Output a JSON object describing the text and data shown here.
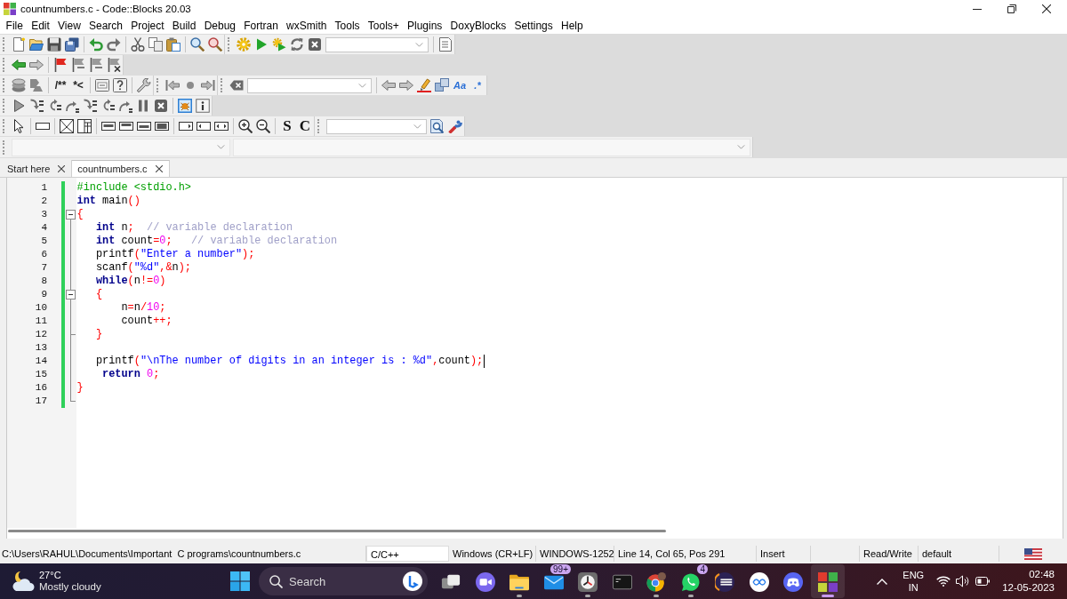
{
  "window": {
    "title": "countnumbers.c - Code::Blocks 20.03"
  },
  "menu": [
    "File",
    "Edit",
    "View",
    "Search",
    "Project",
    "Build",
    "Debug",
    "Fortran",
    "wxSmith",
    "Tools",
    "Tools+",
    "Plugins",
    "DoxyBlocks",
    "Settings",
    "Help"
  ],
  "toolbars": {
    "comment_buttons": [
      "/**",
      "*<"
    ],
    "search_buttons": [
      "Aa",
      ".*"
    ],
    "debug_toggles": [
      {
        "selected": true
      },
      {
        "selected": false
      }
    ],
    "wxsmith_buttons": [
      "S",
      "C"
    ]
  },
  "tabs": [
    {
      "label": "Start here",
      "selected": false
    },
    {
      "label": "countnumbers.c",
      "selected": true
    }
  ],
  "editor": {
    "lines": [
      {
        "number": "1",
        "modified": true,
        "kind": "plain",
        "caret": false,
        "tokens": [
          {
            "kind": "preprocessor",
            "text": "#include <stdio.h>"
          }
        ]
      },
      {
        "number": "2",
        "modified": true,
        "kind": "plain",
        "caret": false,
        "tokens": [
          {
            "kind": "keyword",
            "text": "int"
          },
          {
            "kind": "plain",
            "text": " main"
          },
          {
            "kind": "operator",
            "text": "()"
          }
        ]
      },
      {
        "number": "3",
        "modified": true,
        "kind": "fold_start",
        "caret": false,
        "tokens": [
          {
            "kind": "operator",
            "text": "{"
          }
        ]
      },
      {
        "number": "4",
        "modified": true,
        "kind": "fold_body",
        "caret": false,
        "tokens": [
          {
            "kind": "keyword",
            "text": "   int"
          },
          {
            "kind": "plain",
            "text": " n"
          },
          {
            "kind": "operator",
            "text": ";"
          },
          {
            "kind": "comment",
            "text": "  // variable declaration"
          }
        ]
      },
      {
        "number": "5",
        "modified": true,
        "kind": "fold_body",
        "caret": false,
        "tokens": [
          {
            "kind": "keyword",
            "text": "   int"
          },
          {
            "kind": "plain",
            "text": " count"
          },
          {
            "kind": "operator",
            "text": "="
          },
          {
            "kind": "number",
            "text": "0"
          },
          {
            "kind": "operator",
            "text": ";"
          },
          {
            "kind": "comment",
            "text": "   // variable declaration"
          }
        ]
      },
      {
        "number": "6",
        "modified": true,
        "kind": "fold_body",
        "caret": false,
        "tokens": [
          {
            "kind": "plain",
            "text": "   printf"
          },
          {
            "kind": "operator",
            "text": "("
          },
          {
            "kind": "string",
            "text": "\"Enter a number\""
          },
          {
            "kind": "operator",
            "text": ");"
          }
        ]
      },
      {
        "number": "7",
        "modified": true,
        "kind": "fold_body",
        "caret": false,
        "tokens": [
          {
            "kind": "plain",
            "text": "   scanf"
          },
          {
            "kind": "operator",
            "text": "("
          },
          {
            "kind": "string",
            "text": "\"%d\""
          },
          {
            "kind": "operator",
            "text": ",&"
          },
          {
            "kind": "plain",
            "text": "n"
          },
          {
            "kind": "operator",
            "text": ");"
          }
        ]
      },
      {
        "number": "8",
        "modified": true,
        "kind": "fold_body",
        "caret": false,
        "tokens": [
          {
            "kind": "keyword",
            "text": "   while"
          },
          {
            "kind": "operator",
            "text": "("
          },
          {
            "kind": "plain",
            "text": "n"
          },
          {
            "kind": "operator",
            "text": "!="
          },
          {
            "kind": "number",
            "text": "0"
          },
          {
            "kind": "operator",
            "text": ")"
          }
        ]
      },
      {
        "number": "9",
        "modified": true,
        "kind": "fold_start_inner",
        "caret": false,
        "tokens": [
          {
            "kind": "operator",
            "text": "   {"
          }
        ]
      },
      {
        "number": "10",
        "modified": true,
        "kind": "fold_body",
        "caret": false,
        "tokens": [
          {
            "kind": "plain",
            "text": "       n"
          },
          {
            "kind": "operator",
            "text": "="
          },
          {
            "kind": "plain",
            "text": "n"
          },
          {
            "kind": "operator",
            "text": "/"
          },
          {
            "kind": "number",
            "text": "10"
          },
          {
            "kind": "operator",
            "text": ";"
          }
        ]
      },
      {
        "number": "11",
        "modified": true,
        "kind": "fold_body",
        "caret": false,
        "tokens": [
          {
            "kind": "plain",
            "text": "       count"
          },
          {
            "kind": "operator",
            "text": "++;"
          }
        ]
      },
      {
        "number": "12",
        "modified": true,
        "kind": "fold_end_inner",
        "caret": false,
        "tokens": [
          {
            "kind": "operator",
            "text": "   }"
          }
        ]
      },
      {
        "number": "13",
        "modified": true,
        "kind": "fold_body",
        "caret": false
      },
      {
        "number": "14",
        "modified": true,
        "kind": "fold_body",
        "caret": true,
        "tokens": [
          {
            "kind": "plain",
            "text": "   printf"
          },
          {
            "kind": "operator",
            "text": "("
          },
          {
            "kind": "string",
            "text": "\"\\nThe number of digits in an integer is : %d\""
          },
          {
            "kind": "operator",
            "text": ","
          },
          {
            "kind": "plain",
            "text": "count"
          },
          {
            "kind": "operator",
            "text": ");"
          }
        ]
      },
      {
        "number": "15",
        "modified": true,
        "kind": "fold_body",
        "caret": false,
        "tokens": [
          {
            "kind": "keyword",
            "text": "    return"
          },
          {
            "kind": "number",
            "text": " 0"
          },
          {
            "kind": "operator",
            "text": ";"
          }
        ]
      },
      {
        "number": "16",
        "modified": true,
        "kind": "fold_body",
        "caret": false,
        "tokens": [
          {
            "kind": "operator",
            "text": "}"
          }
        ]
      },
      {
        "number": "17",
        "modified": true,
        "kind": "fold_end",
        "caret": false
      }
    ]
  },
  "status_bar": {
    "fields": [
      "C:\\Users\\RAHUL\\Documents\\Important  C programs\\countnumbers.c",
      "C/C++",
      "Windows (CR+LF)",
      "WINDOWS-1252",
      "Line 14, Col 65, Pos 291",
      "Insert",
      "Read/Write",
      "default"
    ]
  },
  "taskbar": {
    "weather": {
      "temperature": "27°C",
      "condition": "Mostly cloudy"
    },
    "search": {
      "placeholder": "Search"
    },
    "apps": [
      {
        "running": false,
        "selected": false
      },
      {
        "running": false,
        "selected": false
      },
      {
        "running": true,
        "selected": false
      },
      {
        "running": false,
        "selected": false,
        "badge": "99+"
      },
      {
        "running": true,
        "selected": false
      },
      {
        "running": false,
        "selected": false
      },
      {
        "running": true,
        "selected": false
      },
      {
        "running": true,
        "selected": false,
        "badge": "4"
      },
      {
        "running": false,
        "selected": false
      },
      {
        "running": false,
        "selected": false
      },
      {
        "running": false,
        "selected": false
      },
      {
        "running": true,
        "selected": true
      }
    ],
    "tray": {
      "language": "ENG",
      "region": "IN",
      "time": "02:48",
      "date": "12-05-2023"
    }
  }
}
